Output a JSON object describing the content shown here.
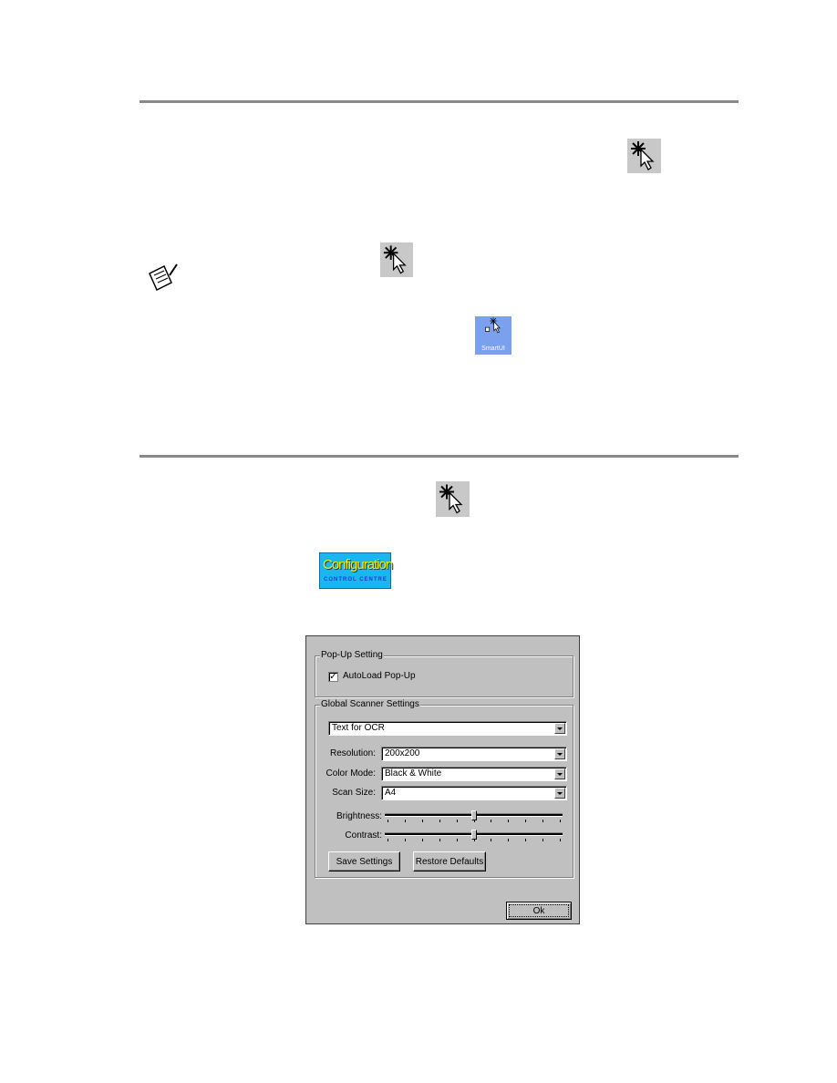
{
  "icons": {
    "smartui_label": "SmartUI",
    "config_title": "Configuration",
    "config_subtitle": "CONTROL CENTRE"
  },
  "dialog": {
    "popup_group": "Pop-Up Setting",
    "autoload_label": "AutoLoad Pop-Up",
    "autoload_checked": true,
    "scanner_group": "Global Scanner Settings",
    "preset": "Text for OCR",
    "resolution_label": "Resolution:",
    "resolution": "200x200",
    "colormode_label": "Color Mode:",
    "colormode": "Black & White",
    "scansize_label": "Scan Size:",
    "scansize": "A4",
    "brightness_label": "Brightness:",
    "brightness_level": 0.5,
    "contrast_label": "Contrast:",
    "contrast_level": 0.5,
    "save_button": "Save Settings",
    "restore_button": "Restore Defaults",
    "ok_button": "Ok"
  }
}
